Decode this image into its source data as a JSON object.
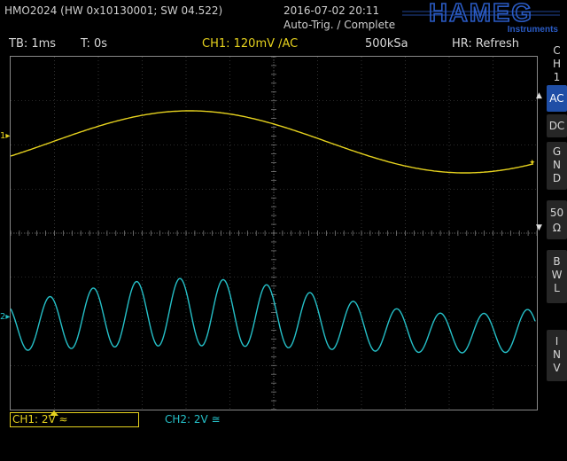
{
  "header": {
    "device": "HMO2024 (HW 0x10130001; SW 04.522)",
    "datetime": "2016-07-02 20:11",
    "status": "Auto-Trig. / Complete",
    "logo_main": "HAMEG",
    "logo_sub": "Instruments"
  },
  "info_bar": {
    "timebase": "TB: 1ms",
    "trigger_time": "T: 0s",
    "channel1": "CH1: 120mV ∕AC",
    "sample_rate": "500kSa",
    "hr_mode": "HR: Refresh"
  },
  "side_menu": {
    "channel": [
      "C",
      "H",
      "1"
    ],
    "items": [
      {
        "label": [
          "AC"
        ],
        "selected": true
      },
      {
        "label": [
          "DC"
        ],
        "selected": false
      },
      {
        "label": [
          "G",
          "N",
          "D"
        ],
        "selected": false
      },
      {
        "label": [
          "50",
          "Ω"
        ],
        "selected": false
      },
      {
        "label": [
          "B",
          "W",
          "L"
        ],
        "selected": false
      },
      {
        "label": [
          "I",
          "N",
          "V"
        ],
        "selected": false
      }
    ]
  },
  "markers": {
    "ch1": "1",
    "ch2": "2"
  },
  "footer": {
    "ch1": "CH1: 2V ≈",
    "ch2": "CH2: 2V ≅"
  },
  "colors": {
    "ch1": "#e6d21e",
    "ch2": "#25c0c8",
    "grid": "#555555",
    "selected": "#1f4ea6"
  }
}
